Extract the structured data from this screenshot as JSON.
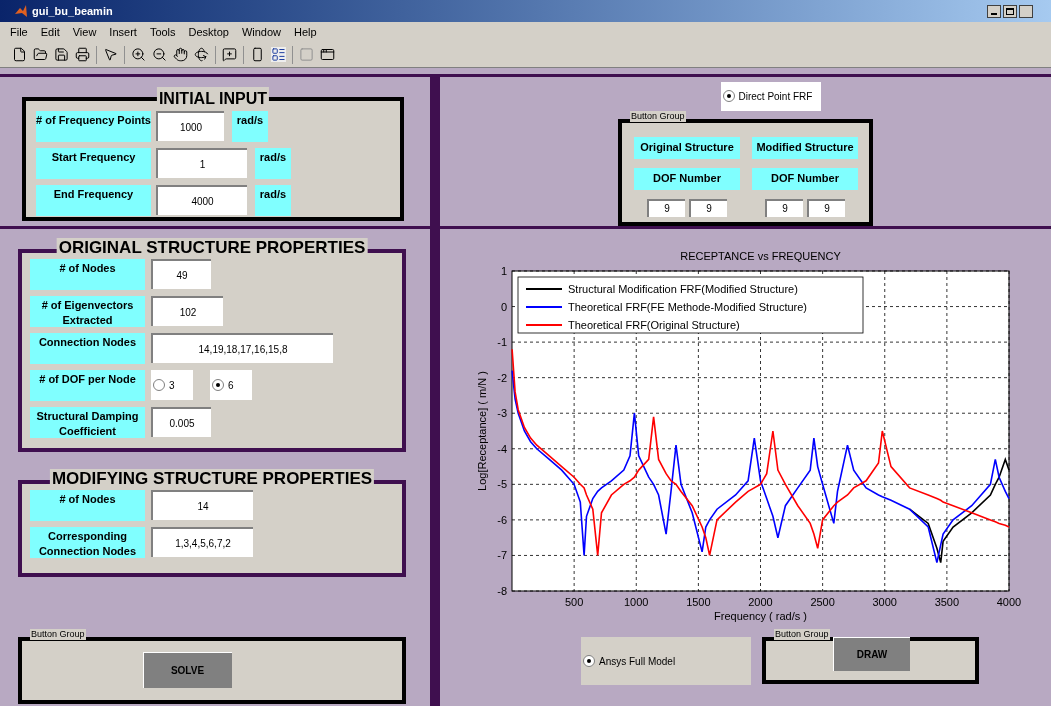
{
  "window": {
    "title": "gui_bu_beamin"
  },
  "menu": [
    "File",
    "Edit",
    "View",
    "Insert",
    "Tools",
    "Desktop",
    "Window",
    "Help"
  ],
  "initial_input": {
    "title": "INITIAL INPUT",
    "rows": [
      {
        "label": "# of Frequency Points",
        "value": "1000",
        "unit": "rad/s"
      },
      {
        "label": "Start Frequency",
        "value": "1",
        "unit": "rad/s"
      },
      {
        "label": "End Frequency",
        "value": "4000",
        "unit": "rad/s"
      }
    ]
  },
  "original_structure": {
    "title": "ORIGINAL STRUCTURE PROPERTIES",
    "fields": [
      {
        "kind": "text",
        "label": "# of Nodes",
        "value": "49"
      },
      {
        "kind": "text",
        "label": "# of Eigenvectors Extracted",
        "value": "102"
      },
      {
        "kind": "text",
        "label": "Connection Nodes",
        "value": "14,19,18,17,16,15,8"
      },
      {
        "kind": "radio",
        "label": "# of DOF per Node",
        "options": [
          {
            "label": "3",
            "selected": false
          },
          {
            "label": "6",
            "selected": true
          }
        ]
      },
      {
        "kind": "text",
        "label": "Structural Damping Coefficient",
        "value": "0.005"
      }
    ]
  },
  "modifying_structure": {
    "title": "MODIFYING STRUCTURE PROPERTIES",
    "fields": [
      {
        "kind": "text",
        "label": "# of Nodes",
        "value": "14"
      },
      {
        "kind": "text",
        "label": "Corresponding Connection Nodes",
        "value": "1,3,4,5,6,7,2"
      }
    ]
  },
  "solve_group": {
    "title": "Button Group",
    "button": "SOLVE"
  },
  "frf_option": {
    "label": "Direct Point FRF",
    "selected": true
  },
  "dof_group": {
    "title": "Button Group",
    "columns": [
      {
        "heading": "Original Structure",
        "subheading": "DOF Number",
        "values": [
          "9",
          "9"
        ]
      },
      {
        "heading": "Modified Structure",
        "subheading": "DOF Number",
        "values": [
          "9",
          "9"
        ]
      }
    ]
  },
  "chart": {
    "chart_data": {
      "type": "line",
      "title": "RECEPTANCE vs FREQUENCY",
      "xlabel": "Frequency ( rad/s )",
      "ylabel": "Log[Receptance] ( m/N )",
      "x": [
        1,
        25,
        50,
        100,
        150,
        200,
        300,
        400,
        500,
        550,
        580,
        600,
        650,
        690,
        720,
        800,
        900,
        950,
        985,
        1020,
        1100,
        1140,
        1180,
        1240,
        1280,
        1320,
        1360,
        1450,
        1530,
        1560,
        1590,
        1650,
        1800,
        1900,
        1950,
        2000,
        2050,
        2100,
        2140,
        2200,
        2300,
        2400,
        2430,
        2460,
        2500,
        2590,
        2620,
        2700,
        2750,
        2850,
        2950,
        2980,
        3050,
        3200,
        3350,
        3420,
        3450,
        3470,
        3550,
        3700,
        3850,
        3890,
        3920,
        3970,
        4000
      ],
      "series": [
        {
          "name": "Structural Modification FRF(Modified Structure)",
          "color": "#000000",
          "values": [
            null,
            null,
            null,
            null,
            null,
            null,
            null,
            null,
            null,
            null,
            null,
            null,
            null,
            null,
            null,
            null,
            null,
            null,
            null,
            null,
            null,
            null,
            null,
            null,
            null,
            null,
            null,
            null,
            null,
            null,
            null,
            null,
            null,
            null,
            null,
            null,
            null,
            null,
            null,
            null,
            null,
            null,
            null,
            null,
            null,
            null,
            null,
            null,
            null,
            null,
            null,
            null,
            null,
            -5.7,
            -6.1,
            -6.8,
            -7.2,
            -6.6,
            -6.2,
            -5.8,
            -5.3,
            -5.0,
            -4.8,
            -4.3,
            -4.6
          ]
        },
        {
          "name": "Theoretical FRF(FE Methode-Modified Structure)",
          "color": "#0000ff",
          "values": [
            -1.8,
            -2.6,
            -3.0,
            -3.5,
            -3.8,
            -4.0,
            -4.3,
            -4.6,
            -5.0,
            -5.5,
            -7.0,
            -5.9,
            -5.4,
            -5.2,
            -5.1,
            -4.9,
            -4.6,
            -4.2,
            -3.0,
            -4.2,
            -4.8,
            -5.0,
            -5.3,
            -6.4,
            -5.2,
            -3.9,
            -5.0,
            -5.8,
            -6.9,
            -6.2,
            -6.0,
            -5.7,
            -5.3,
            -4.9,
            -3.7,
            -4.9,
            -5.4,
            -5.9,
            -6.5,
            -5.6,
            -5.1,
            -4.6,
            -3.7,
            -4.5,
            -5.0,
            -6.1,
            -5.2,
            -3.9,
            -4.6,
            -5.1,
            -5.3,
            -5.35,
            -5.45,
            -5.7,
            -6.2,
            -7.2,
            -6.7,
            -6.4,
            -6.0,
            -5.6,
            -5.0,
            -4.3,
            -4.8,
            -5.2,
            -5.4
          ]
        },
        {
          "name": "Theoretical FRF(Original Structure)",
          "color": "#ff0000",
          "values": [
            -1.2,
            -2.4,
            -2.9,
            -3.4,
            -3.7,
            -3.9,
            -4.2,
            -4.5,
            -4.8,
            -5.0,
            -5.1,
            -5.3,
            -5.7,
            -7.0,
            -5.8,
            -5.3,
            -5.0,
            -4.9,
            -4.8,
            -4.6,
            -4.3,
            -3.1,
            -4.3,
            -4.7,
            -4.9,
            -5.0,
            -5.2,
            -5.6,
            -6.2,
            -6.5,
            -7.0,
            -6.0,
            -5.5,
            -5.2,
            -5.1,
            -5.0,
            -4.7,
            -3.5,
            -4.6,
            -5.0,
            -5.6,
            -6.1,
            -6.4,
            -6.8,
            -6.0,
            -5.6,
            -5.5,
            -5.3,
            -5.1,
            -4.9,
            -4.4,
            -3.5,
            -4.5,
            -5.1,
            -5.3,
            -5.4,
            -5.45,
            -5.5,
            -5.6,
            -5.8,
            -6.0,
            -6.05,
            -6.1,
            -6.15,
            -6.2
          ]
        }
      ],
      "xlim": [
        0,
        4000
      ],
      "ylim": [
        -8,
        1
      ],
      "xticks": [
        {
          "value": 500,
          "label": "500"
        },
        {
          "value": 1000,
          "label": "1000"
        },
        {
          "value": 1500,
          "label": "1500"
        },
        {
          "value": 2000,
          "label": "2000"
        },
        {
          "value": 2500,
          "label": "2500"
        },
        {
          "value": 3000,
          "label": "3000"
        },
        {
          "value": 3500,
          "label": "3500"
        },
        {
          "value": 4000,
          "label": "4000"
        }
      ],
      "yticks": [
        {
          "value": -8,
          "label": "-8"
        },
        {
          "value": -7,
          "label": "-7"
        },
        {
          "value": -6,
          "label": "-6"
        },
        {
          "value": -5,
          "label": "-5"
        },
        {
          "value": -4,
          "label": "-4"
        },
        {
          "value": -3,
          "label": "-3"
        },
        {
          "value": -2,
          "label": "-2"
        },
        {
          "value": -1,
          "label": "-1"
        },
        {
          "value": 0,
          "label": "0"
        },
        {
          "value": 1,
          "label": "1"
        }
      ],
      "grid": true,
      "legend": true
    }
  },
  "model_option": {
    "label": "Ansys Full Model",
    "selected": true
  },
  "draw_group": {
    "title": "Button Group",
    "button": "DRAW"
  }
}
